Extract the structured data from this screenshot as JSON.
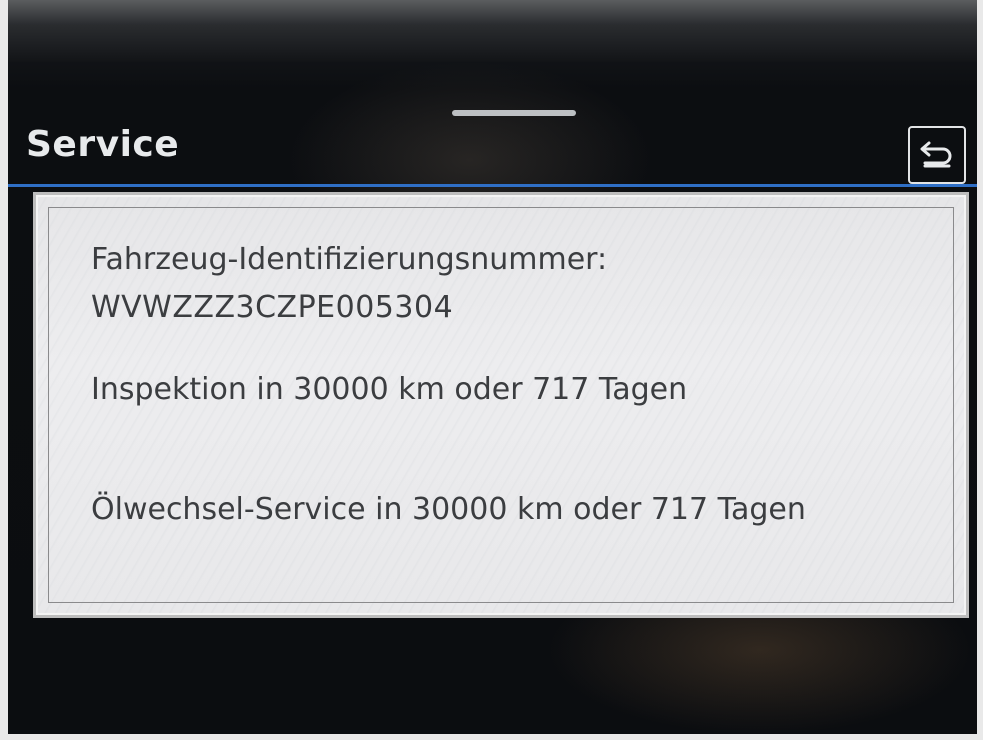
{
  "header": {
    "title": "Service",
    "back_icon": "back-arrow-icon",
    "accent_color": "#2f6fc6"
  },
  "service_info": {
    "vin_label": "Fahrzeug-Identifizierungsnummer:",
    "vin_value": "WVWZZZ3CZPE005304",
    "inspection": "Inspektion in 30000 km oder 717 Tagen",
    "oil_service": "Ölwechsel-Service in 30000 km oder 717 Tagen"
  }
}
